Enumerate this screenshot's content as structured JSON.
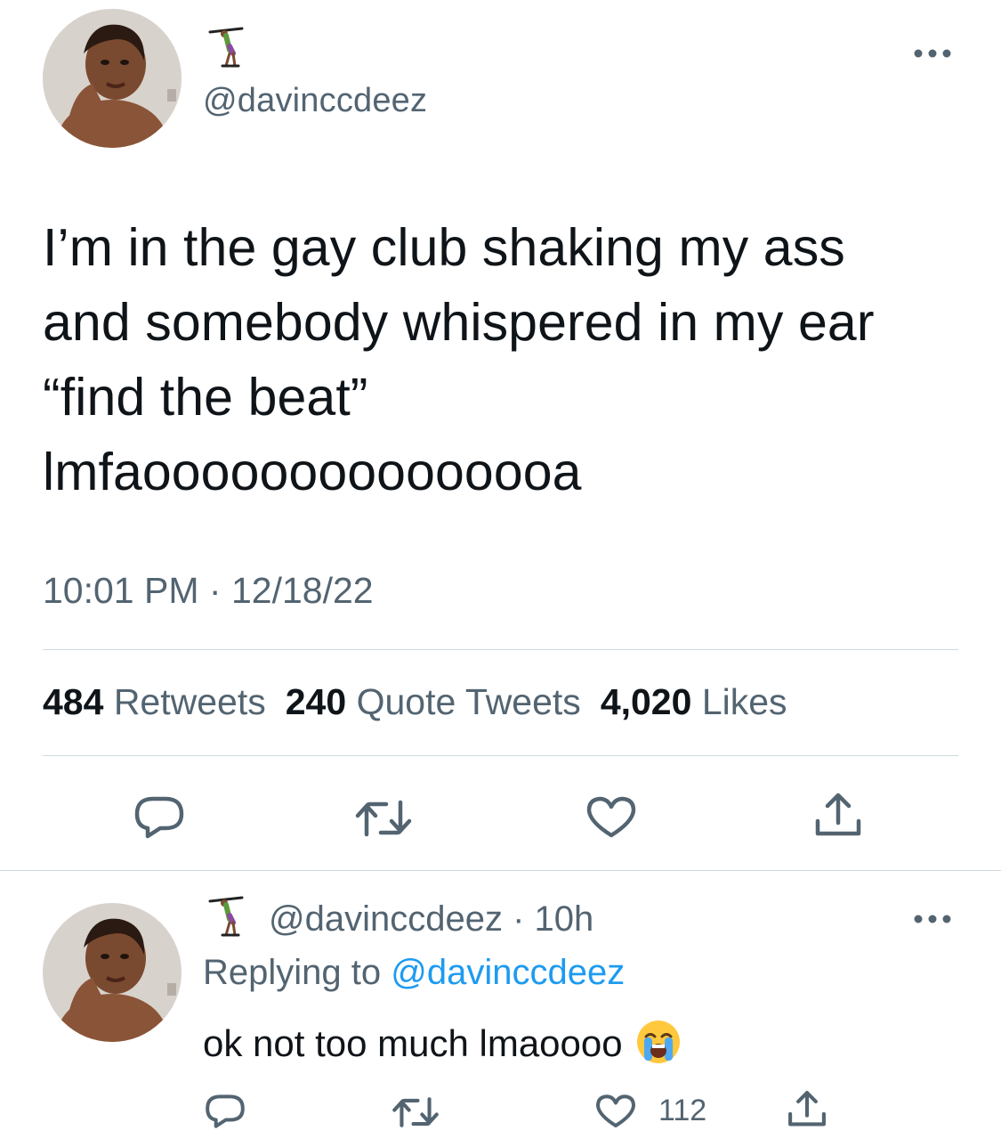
{
  "tweet": {
    "handle": "@davinccdeez",
    "text_lines": [
      "I’m in the gay club shaking my ass",
      "and somebody whispered in my ear",
      "“find the beat”",
      "lmfaooooooooooooooa"
    ],
    "time": "10:01 PM",
    "separator": "·",
    "date": "12/18/22",
    "stats": {
      "retweets_count": "484",
      "retweets_label": "Retweets",
      "quotes_count": "240",
      "quotes_label": "Quote Tweets",
      "likes_count": "4,020",
      "likes_label": "Likes"
    }
  },
  "reply": {
    "handle": "@davinccdeez",
    "separator": "·",
    "age": "10h",
    "replying_prefix": "Replying to",
    "replying_to": "@davinccdeez",
    "text": "ok not too much lmaoooo",
    "emoji": "loudly-crying-face",
    "like_count": "112"
  },
  "icons": {
    "reply": "reply-icon",
    "retweet": "retweet-icon",
    "like": "heart-icon",
    "share": "share-icon",
    "more": "more-icon",
    "badge": "gymnast-emoji-icon"
  },
  "colors": {
    "text": "#0f1419",
    "secondary": "#536471",
    "link": "#1d9bf0",
    "divider": "#cfd9de"
  }
}
